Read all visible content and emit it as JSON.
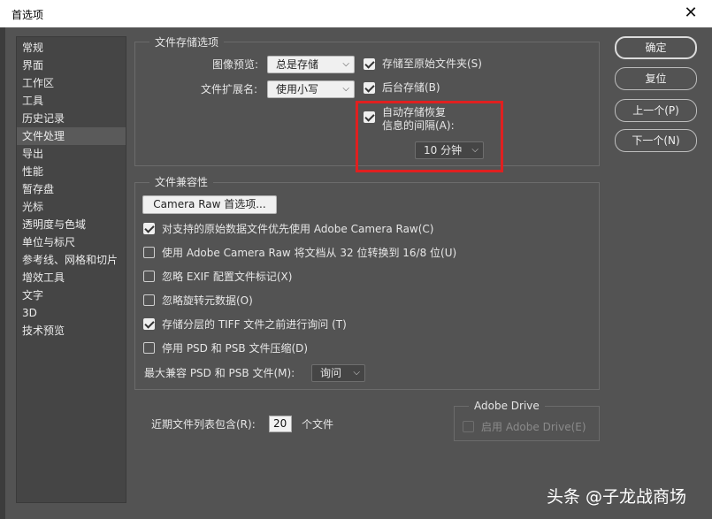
{
  "window": {
    "title": "首选项"
  },
  "sidebar": {
    "items": [
      {
        "label": "常规"
      },
      {
        "label": "界面"
      },
      {
        "label": "工作区"
      },
      {
        "label": "工具"
      },
      {
        "label": "历史记录"
      },
      {
        "label": "文件处理",
        "selected": true
      },
      {
        "label": "导出"
      },
      {
        "label": "性能"
      },
      {
        "label": "暂存盘"
      },
      {
        "label": "光标"
      },
      {
        "label": "透明度与色域"
      },
      {
        "label": "单位与标尺"
      },
      {
        "label": "参考线、网格和切片"
      },
      {
        "label": "增效工具"
      },
      {
        "label": "文字"
      },
      {
        "label": "3D"
      },
      {
        "label": "技术预览"
      }
    ]
  },
  "file_saving": {
    "title": "文件存储选项",
    "image_preview_label": "图像预览:",
    "image_preview_value": "总是存储",
    "extension_label": "文件扩展名:",
    "extension_value": "使用小写",
    "save_as_original_label": "存储至原始文件夹(S)",
    "save_as_original_checked": true,
    "background_save_label": "后台存储(B)",
    "background_save_checked": true,
    "auto_save_label_line1": "自动存储恢复",
    "auto_save_label_line2": "信息的间隔(A):",
    "auto_save_checked": true,
    "auto_save_interval": "10 分钟"
  },
  "compatibility": {
    "title": "文件兼容性",
    "camera_raw_button": "Camera Raw 首选项...",
    "options": [
      {
        "label": "对支持的原始数据文件优先使用 Adobe Camera Raw(C)",
        "checked": true
      },
      {
        "label": "使用 Adobe Camera Raw 将文档从 32 位转换到 16/8 位(U)",
        "checked": false
      },
      {
        "label": "忽略 EXIF 配置文件标记(X)",
        "checked": false
      },
      {
        "label": "忽略旋转元数据(O)",
        "checked": false
      },
      {
        "label": "存储分层的 TIFF 文件之前进行询问 (T)",
        "checked": true
      },
      {
        "label": "停用 PSD 和 PSB 文件压缩(D)",
        "checked": false
      }
    ],
    "max_compat_label": "最大兼容 PSD 和 PSB 文件(M):",
    "max_compat_value": "询问"
  },
  "recent": {
    "label_before": "近期文件列表包含(R):",
    "value": "20",
    "label_after": "个文件"
  },
  "adobe_drive": {
    "title": "Adobe Drive",
    "enable_label": "启用 Adobe Drive(E)",
    "enabled": false
  },
  "buttons": {
    "ok": "确定",
    "reset": "复位",
    "prev": "上一个(P)",
    "next": "下一个(N)"
  },
  "watermark": "头条 @子龙战商场",
  "icons": {
    "close": "close-icon",
    "dropdown": "chevron-down-icon",
    "checkbox": "checkmark-icon"
  },
  "colors": {
    "dialog_bg": "#535353",
    "highlight_box": "#e02020"
  }
}
